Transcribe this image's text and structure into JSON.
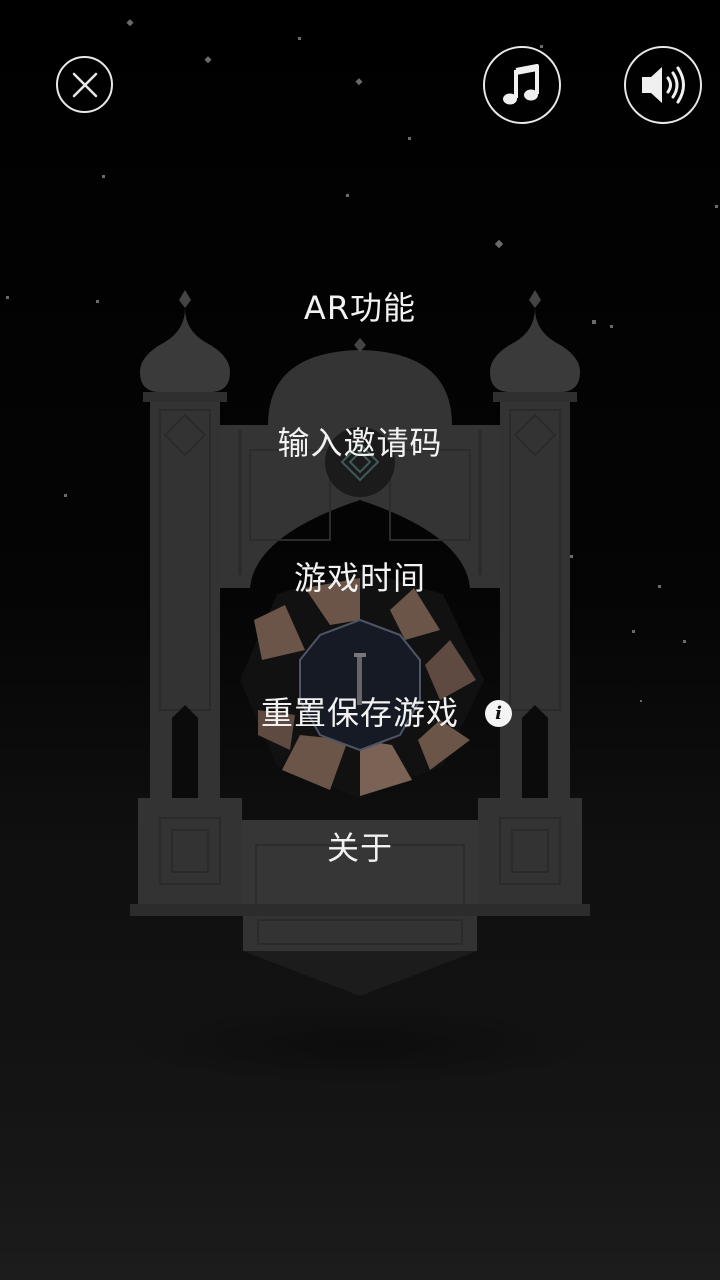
{
  "controls": {
    "close_icon": "close-icon",
    "music_icon": "music-note-icon",
    "sound_icon": "speaker-volume-icon"
  },
  "menu": {
    "ar": "AR功能",
    "invite": "输入邀请码",
    "playtime": "游戏时间",
    "reset": "重置保存游戏",
    "about": "关于"
  },
  "reset_info": {
    "icon": "info-icon",
    "glyph": "i"
  },
  "colors": {
    "background": "#000000",
    "structure": "#3a3a3a",
    "text": "#f2f2f2",
    "wheel_segment": "#6b5448"
  }
}
